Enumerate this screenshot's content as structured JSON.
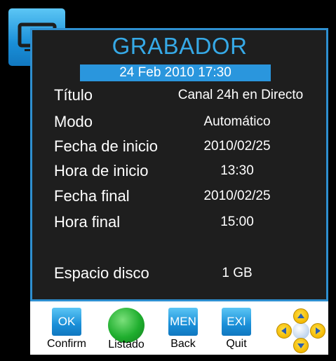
{
  "screen": {
    "title": "GRABADOR",
    "datetime": "24 Feb 2010  17:30",
    "colors": {
      "accent": "#2a96dd",
      "panel": "#1e1e1e",
      "title": "#36a9e6"
    }
  },
  "tv_icon": "tv-icon",
  "fields": [
    {
      "label": "Título",
      "value": "Canal 24h en Directo"
    },
    {
      "label": "Modo",
      "value": "Automático"
    },
    {
      "label": "Fecha de inicio",
      "value": "2010/02/25"
    },
    {
      "label": "Hora de inicio",
      "value": "13:30"
    },
    {
      "label": "Fecha final",
      "value": "2010/02/25"
    },
    {
      "label": "Hora final",
      "value": "15:00"
    },
    {
      "label": "Espacio disco",
      "value": "1 GB"
    }
  ],
  "toolbar": {
    "ok": {
      "key": "OK",
      "label": "Confirm"
    },
    "list": {
      "label": "Listado"
    },
    "menu": {
      "key": "MEN",
      "label": "Back"
    },
    "exit": {
      "key": "EXI",
      "label": "Quit"
    },
    "dpad_icon": "direction-pad-icon"
  }
}
